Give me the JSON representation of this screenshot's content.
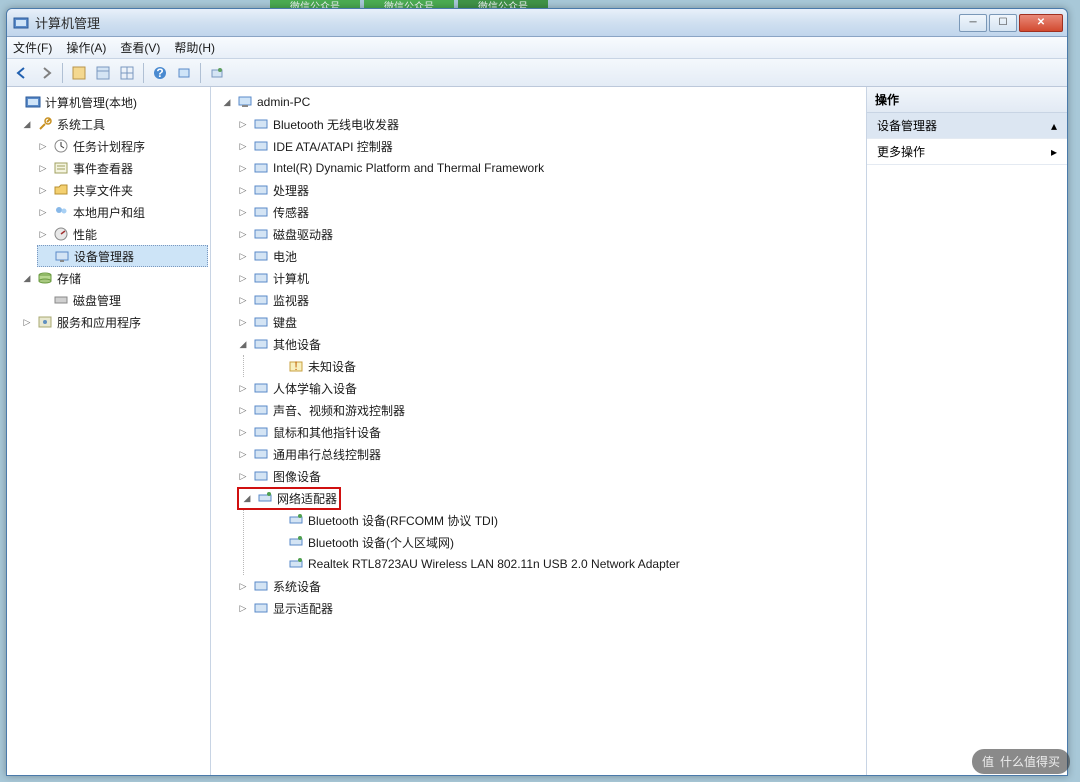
{
  "tabs_hint": [
    "微信公众号",
    "微信公众号",
    "微信公众号"
  ],
  "window": {
    "title": "计算机管理",
    "buttons": {
      "min": "─",
      "max": "☐",
      "close": "✕"
    }
  },
  "menubar": [
    "文件(F)",
    "操作(A)",
    "查看(V)",
    "帮助(H)"
  ],
  "left_tree": {
    "root": "计算机管理(本地)",
    "system_tools": {
      "label": "系统工具",
      "children": [
        "任务计划程序",
        "事件查看器",
        "共享文件夹",
        "本地用户和组",
        "性能",
        "设备管理器"
      ]
    },
    "storage": {
      "label": "存储",
      "children": [
        "磁盘管理"
      ]
    },
    "services": {
      "label": "服务和应用程序"
    }
  },
  "center_tree": {
    "root": "admin-PC",
    "items": [
      {
        "label": "Bluetooth 无线电收发器",
        "exp": "▷"
      },
      {
        "label": "IDE ATA/ATAPI 控制器",
        "exp": "▷"
      },
      {
        "label": "Intel(R) Dynamic Platform and Thermal Framework",
        "exp": "▷"
      },
      {
        "label": "处理器",
        "exp": "▷"
      },
      {
        "label": "传感器",
        "exp": "▷"
      },
      {
        "label": "磁盘驱动器",
        "exp": "▷"
      },
      {
        "label": "电池",
        "exp": "▷"
      },
      {
        "label": "计算机",
        "exp": "▷"
      },
      {
        "label": "监视器",
        "exp": "▷"
      },
      {
        "label": "键盘",
        "exp": "▷"
      },
      {
        "label": "其他设备",
        "exp": "◢",
        "children": [
          {
            "label": "未知设备"
          }
        ]
      },
      {
        "label": "人体学输入设备",
        "exp": "▷"
      },
      {
        "label": "声音、视频和游戏控制器",
        "exp": "▷"
      },
      {
        "label": "鼠标和其他指针设备",
        "exp": "▷"
      },
      {
        "label": "通用串行总线控制器",
        "exp": "▷"
      },
      {
        "label": "图像设备",
        "exp": "▷"
      },
      {
        "label": "网络适配器",
        "exp": "◢",
        "highlight": true,
        "children": [
          {
            "label": "Bluetooth 设备(RFCOMM 协议 TDI)"
          },
          {
            "label": "Bluetooth 设备(个人区域网)"
          },
          {
            "label": "Realtek RTL8723AU Wireless LAN 802.11n USB 2.0 Network Adapter"
          }
        ]
      },
      {
        "label": "系统设备",
        "exp": "▷"
      },
      {
        "label": "显示适配器",
        "exp": "▷"
      }
    ]
  },
  "actions_pane": {
    "header": "操作",
    "row1": "设备管理器",
    "row2": "更多操作"
  },
  "watermark": "什么值得买"
}
